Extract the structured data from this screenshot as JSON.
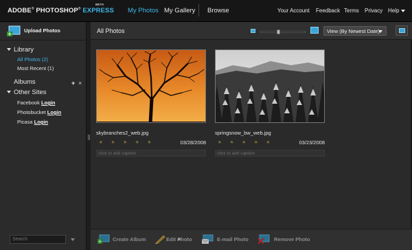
{
  "brand": {
    "adobe": "ADOBE",
    "photoshop": "PHOTOSHOP",
    "express": "EXPRESS",
    "beta": "BETA",
    "reg": "®"
  },
  "nav": {
    "my_photos": "My Photos",
    "my_gallery": "My Gallery",
    "browse": "Browse"
  },
  "top_links": {
    "account": "Your Account",
    "feedback": "Feedback",
    "terms": "Terms",
    "privacy": "Privacy",
    "help": "Help"
  },
  "sidebar": {
    "upload_label": "Upload Photos",
    "library_label": "Library",
    "all_photos": "All Photos (2)",
    "most_recent": "Most Recent (1)",
    "albums_label": "Albums",
    "add_symbol": "+",
    "close_symbol": "×",
    "other_sites_label": "Other Sites",
    "sites": [
      {
        "name": "Facebook",
        "action": "Login"
      },
      {
        "name": "Photobucket",
        "action": "Login"
      },
      {
        "name": "Picasa",
        "action": "Login"
      }
    ],
    "search_placeholder": "Search"
  },
  "main": {
    "title": "All Photos",
    "sort_label": "View (By Newest Date)",
    "photos": [
      {
        "filename": "skybranches2_web.jpg",
        "date": "03/28/2008",
        "stars": "★ ★ ★ ★ ★",
        "rating": 0,
        "caption_placeholder": "click to add caption"
      },
      {
        "filename": "springsnow_bw_web.jpg",
        "date": "03/23/2008",
        "stars": "★ ★ ★ ★ ★",
        "rating": 0,
        "caption_placeholder": "click to add caption"
      }
    ]
  },
  "toolbar": {
    "create_album": "Create Album",
    "edit_photo": "Edit Photo",
    "email_photo": "E-mail Photo",
    "remove_photo": "Remove Photo"
  },
  "icons": [
    "upload-photos-icon",
    "triangle-down-icon",
    "add-icon",
    "close-icon",
    "zoom-small-icon",
    "zoom-large-icon",
    "view-toggle-icon",
    "create-album-icon",
    "edit-photo-icon",
    "email-photo-icon",
    "remove-photo-icon"
  ],
  "colors": {
    "accent": "#3fb6e8",
    "background": "#2a2a2a",
    "topbar": "#161616",
    "sidebar": "#2b2b2b"
  }
}
